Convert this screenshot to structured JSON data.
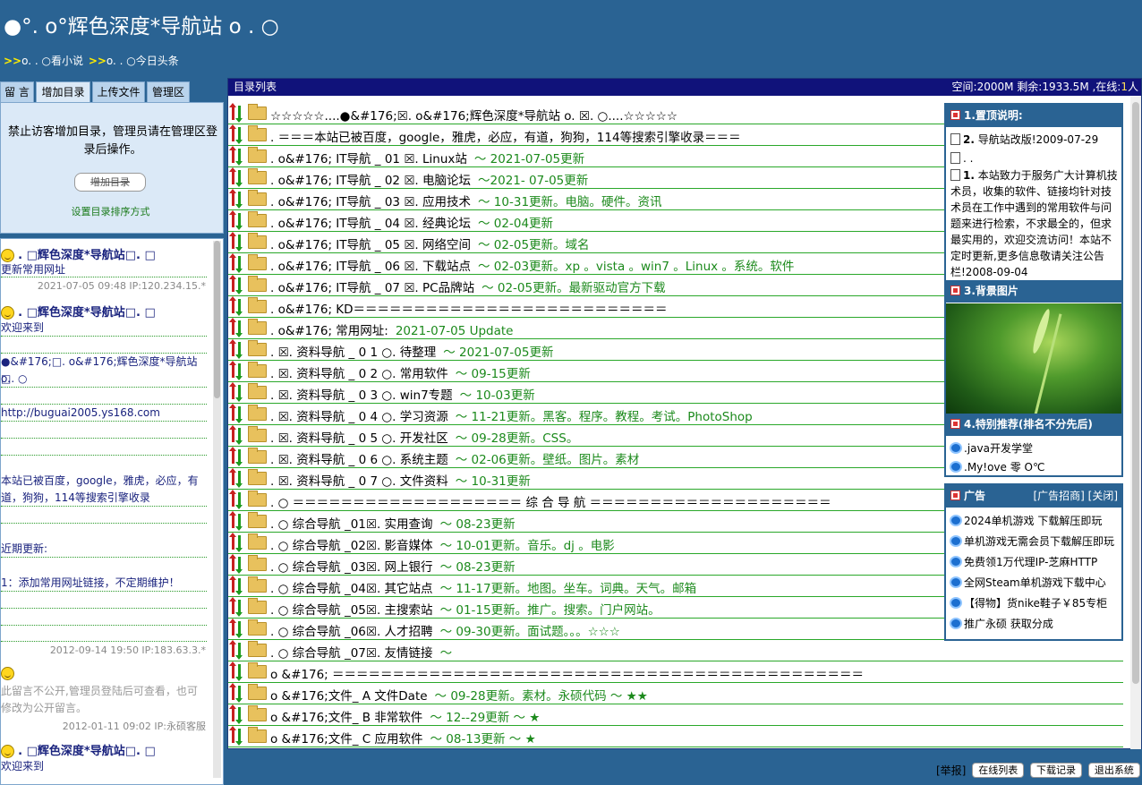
{
  "site": {
    "title": "●°. o°辉色深度*导航站 o . ○",
    "nav": [
      {
        "arrow": ">>",
        "label": "o. . ○看小说"
      },
      {
        "arrow": ">>",
        "label": "o. . ○今日头条"
      }
    ]
  },
  "left": {
    "tabs": [
      "留 言",
      "增加目录",
      "上传文件",
      "管理区"
    ],
    "active_tab": "增加目录",
    "notice": "禁止访客增加目录，管理员请在管理区登录后操作。",
    "notice_line1": "禁止访客增加目录，管理员请在管理区登",
    "notice_line2": "录后操作。",
    "add_button": "增加目录",
    "sort_link": "设置目录排序方式"
  },
  "guestbook": {
    "entry1": {
      "name_prefix": ". □",
      "name": "辉色深度*导航站",
      "name_suffix": "□. □",
      "text": "更新常用网址",
      "meta": "2021-07-05 09:48 IP:120.234.15.*"
    },
    "entry2": {
      "name_prefix": ". □",
      "name": "辉色深度*导航站",
      "name_suffix": "□. □",
      "lines": [
        "欢迎来到",
        "●&#176;□. o&#176;辉色深度*导航站 o.",
        "□. ○",
        "http://buguai2005.ys168.com",
        "本站已被百度，google，雅虎，必应，有",
        "道，狗狗，114等搜索引擎收录",
        "近期更新:",
        "1：添加常用网址链接，不定期维护！"
      ],
      "meta": "2012-09-14 19:50 IP:183.63.3.*"
    },
    "entry3": {
      "text_line1": "此留言不公开,管理员登陆后可查看，也可",
      "text_line2": "修改为公开留言。",
      "meta": "2012-01-11 09:02 IP:永硕客服"
    },
    "entry4": {
      "name_prefix": ". □",
      "name": "辉色深度*导航站",
      "name_suffix": "□. □",
      "text": "欢迎来到"
    }
  },
  "main": {
    "title": "目录列表",
    "space_label": "空间:2000M 剩余:1933.5M ,在线:",
    "online_count": "1",
    "online_unit": "人",
    "rows": [
      {
        "text": "☆☆☆☆☆....●&#176;☒. o&#176;辉色深度*导航站 o. ☒. ○....☆☆☆☆☆",
        "note": ""
      },
      {
        "text": ". ＝＝＝本站已被百度，google，雅虎，必应，有道，狗狗，114等搜索引擎收录＝＝＝",
        "note": ""
      },
      {
        "text": ". o&#176; IT导航 _ 01 ☒.   Linux站",
        "note": "～ 2021-07-05更新"
      },
      {
        "text": ". o&#176; IT导航 _ 02 ☒.   电脑论坛",
        "note": "～2021- 07-05更新"
      },
      {
        "text": ". o&#176; IT导航 _ 03 ☒.   应用技术",
        "note": "～ 10-31更新。电脑。硬件。资讯"
      },
      {
        "text": ". o&#176; IT导航 _ 04 ☒.   经典论坛",
        "note": "～ 02-04更新"
      },
      {
        "text": ". o&#176; IT导航 _ 05 ☒.   网络空间",
        "note": "～ 02-05更新。域名"
      },
      {
        "text": ". o&#176; IT导航 _ 06 ☒.   下载站点",
        "note": "～ 02-03更新。xp 。vista 。win7 。Linux 。系统。软件"
      },
      {
        "text": ". o&#176; IT导航 _ 07 ☒.   PC品牌站",
        "note": "～ 02-05更新。最新驱动官方下载"
      },
      {
        "text": ". o&#176; KD＝＝＝＝＝＝＝＝＝＝＝＝＝＝＝＝＝＝＝＝＝＝＝＝＝＝",
        "note": ""
      },
      {
        "text": ". o&#176; 常用网址:",
        "note": "2021-07-05 Update"
      },
      {
        "text": ". ☒. 资料导航 _ 0 1 ○. 待整理",
        "note": "～ 2021-07-05更新"
      },
      {
        "text": ". ☒. 资料导航 _ 0 2 ○. 常用软件",
        "note": "～ 09-15更新"
      },
      {
        "text": ". ☒. 资料导航 _ 0 3 ○. win7专题",
        "note": "～ 10-03更新"
      },
      {
        "text": ". ☒. 资料导航 _ 0 4 ○. 学习资源",
        "note": "～ 11-21更新。黑客。程序。教程。考试。PhotoShop"
      },
      {
        "text": ". ☒. 资料导航 _ 0 5 ○. 开发社区",
        "note": "～ 09-28更新。CSS。"
      },
      {
        "text": ". ☒. 资料导航 _ 0 6 ○. 系统主题",
        "note": "～ 02-06更新。壁纸。图片。素材"
      },
      {
        "text": ". ☒. 资料导航 _ 0 7 ○. 文件资料",
        "note": "～ 10-31更新"
      },
      {
        "text": ". ○ ＝＝＝＝＝＝＝＝＝＝＝＝＝＝＝＝＝＝＝ 综 合 导 航 ＝＝＝＝＝＝＝＝＝＝＝＝＝＝＝＝＝＝＝＝",
        "note": ""
      },
      {
        "text": ". ○ 综合导航 _01☒. 实用查询",
        "note": "～ 08-23更新"
      },
      {
        "text": ". ○ 综合导航 _02☒. 影音媒体",
        "note": "～ 10-01更新。音乐。dj 。电影"
      },
      {
        "text": ". ○ 综合导航 _03☒. 网上银行",
        "note": "～ 08-23更新"
      },
      {
        "text": ". ○ 综合导航 _04☒. 其它站点",
        "note": "～ 11-17更新。地图。坐车。词典。天气。邮箱"
      },
      {
        "text": ". ○ 综合导航 _05☒. 主搜索站",
        "note": "～ 01-15更新。推广。搜索。门户网站。"
      },
      {
        "text": ". ○ 综合导航 _06☒. 人才招聘",
        "note": "～ 09-30更新。面试题。。。☆☆☆"
      },
      {
        "text": ". ○ 综合导航 _07☒. 友情链接",
        "note": "～"
      },
      {
        "text": "o &#176; ＝＝＝＝＝＝＝＝＝＝＝＝＝＝＝＝＝＝＝＝＝＝＝＝＝＝＝＝＝＝＝＝＝＝＝＝＝＝＝＝＝＝＝＝",
        "note": ""
      },
      {
        "text": "o &#176;文件_ A 文件Date",
        "note": "～ 09-28更新。素材。永硕代码 ～ ★★"
      },
      {
        "text": "o &#176;文件_ B 非常软件",
        "note": "～ 12--29更新 ～ ★"
      },
      {
        "text": "o &#176;文件_ C 应用软件",
        "note": "～ 08-13更新 ～ ★"
      }
    ]
  },
  "side": {
    "sec1_title": "1.置顶说明:",
    "item1_num": "2.",
    "item1_text": "导航站改版!2009-07-29",
    "item2_text": ". .",
    "item3_num": "1.",
    "item3_text": "本站致力于服务广大计算机技术员，收集的软件、链接均针对技术员在工作中遇到的常用软件与问题来进行检索，不求最全的，但求最实用的，欢迎交流访问！本站不定时更新,更多信息敬请关注公告栏!2008-09-04",
    "sec3_title": "3.背景图片",
    "sec4_title": "4.特别推荐(排名不分先后)",
    "recommend": [
      ".java开发学堂",
      ".My!ove 零 O℃"
    ]
  },
  "ads": {
    "title": "广告",
    "links": "[广告招商] [关闭]",
    "items": [
      "2024单机游戏 下载解压即玩",
      "单机游戏无需会员下载解压即玩",
      "免费领1万代理IP-芝麻HTTP",
      "全网Steam单机游戏下载中心",
      "【得物】货nike鞋子￥85专柜",
      "推广永硕 获取分成"
    ]
  },
  "footer": {
    "report": "[举报]",
    "buttons": [
      "在线列表",
      "下载记录",
      "退出系统"
    ]
  }
}
